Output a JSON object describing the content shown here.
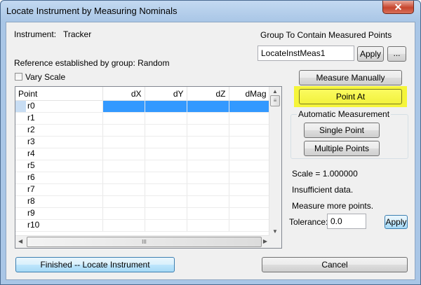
{
  "window": {
    "title": "Locate Instrument by Measuring Nominals",
    "close_glyph": "✕"
  },
  "instrument": {
    "label": "Instrument:",
    "value": "Tracker"
  },
  "reference_text": "Reference established by group: Random",
  "vary_scale": {
    "label": "Vary Scale",
    "checked": false
  },
  "group_box": {
    "label": "Group To Contain Measured Points",
    "value": "LocateInstMeas1",
    "apply_label": "Apply",
    "browse_label": "..."
  },
  "buttons": {
    "measure_manually": "Measure Manually",
    "point_at": "Point At",
    "single_point": "Single Point",
    "multiple_points": "Multiple Points",
    "finished": "Finished -- Locate Instrument",
    "cancel": "Cancel",
    "tolerance_apply": "Apply"
  },
  "auto_measurement_label": "Automatic Measurement",
  "status": {
    "scale": "Scale = 1.000000",
    "line1": "Insufficient data.",
    "line2": "Measure more points."
  },
  "tolerance": {
    "label": "Tolerance:",
    "value": "0.0"
  },
  "grid": {
    "columns": [
      "Point",
      "dX",
      "dY",
      "dZ",
      "dMag"
    ],
    "rows": [
      "r0",
      "r1",
      "r2",
      "r3",
      "r4",
      "r5",
      "r6",
      "r7",
      "r8",
      "r9",
      "r10"
    ],
    "selected_row": "r0",
    "hscroll_grip": "III",
    "vscroll_grip": "≡"
  },
  "colors": {
    "point_at_highlight": "#f5f53a",
    "selection": "#3399ff",
    "title_bar": "#a9c6e6"
  }
}
